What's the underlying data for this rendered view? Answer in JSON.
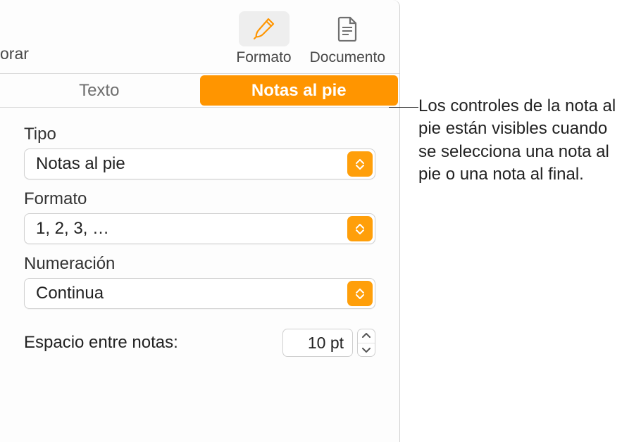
{
  "toolbar": {
    "left_fragment": "orar",
    "items": [
      {
        "label": "Formato",
        "active": true
      },
      {
        "label": "Documento",
        "active": false
      }
    ]
  },
  "tabs": {
    "texto": "Texto",
    "notas": "Notas al pie"
  },
  "fields": {
    "tipo": {
      "label": "Tipo",
      "value": "Notas al pie"
    },
    "formato": {
      "label": "Formato",
      "value": "1, 2, 3, …"
    },
    "numeracion": {
      "label": "Numeración",
      "value": "Continua"
    },
    "espacio": {
      "label": "Espacio entre notas:",
      "value": "10 pt"
    }
  },
  "callout": "Los controles de la nota al pie están visibles cuando se selecciona una nota al pie o una nota al final.",
  "colors": {
    "accent": "#ff9500"
  }
}
